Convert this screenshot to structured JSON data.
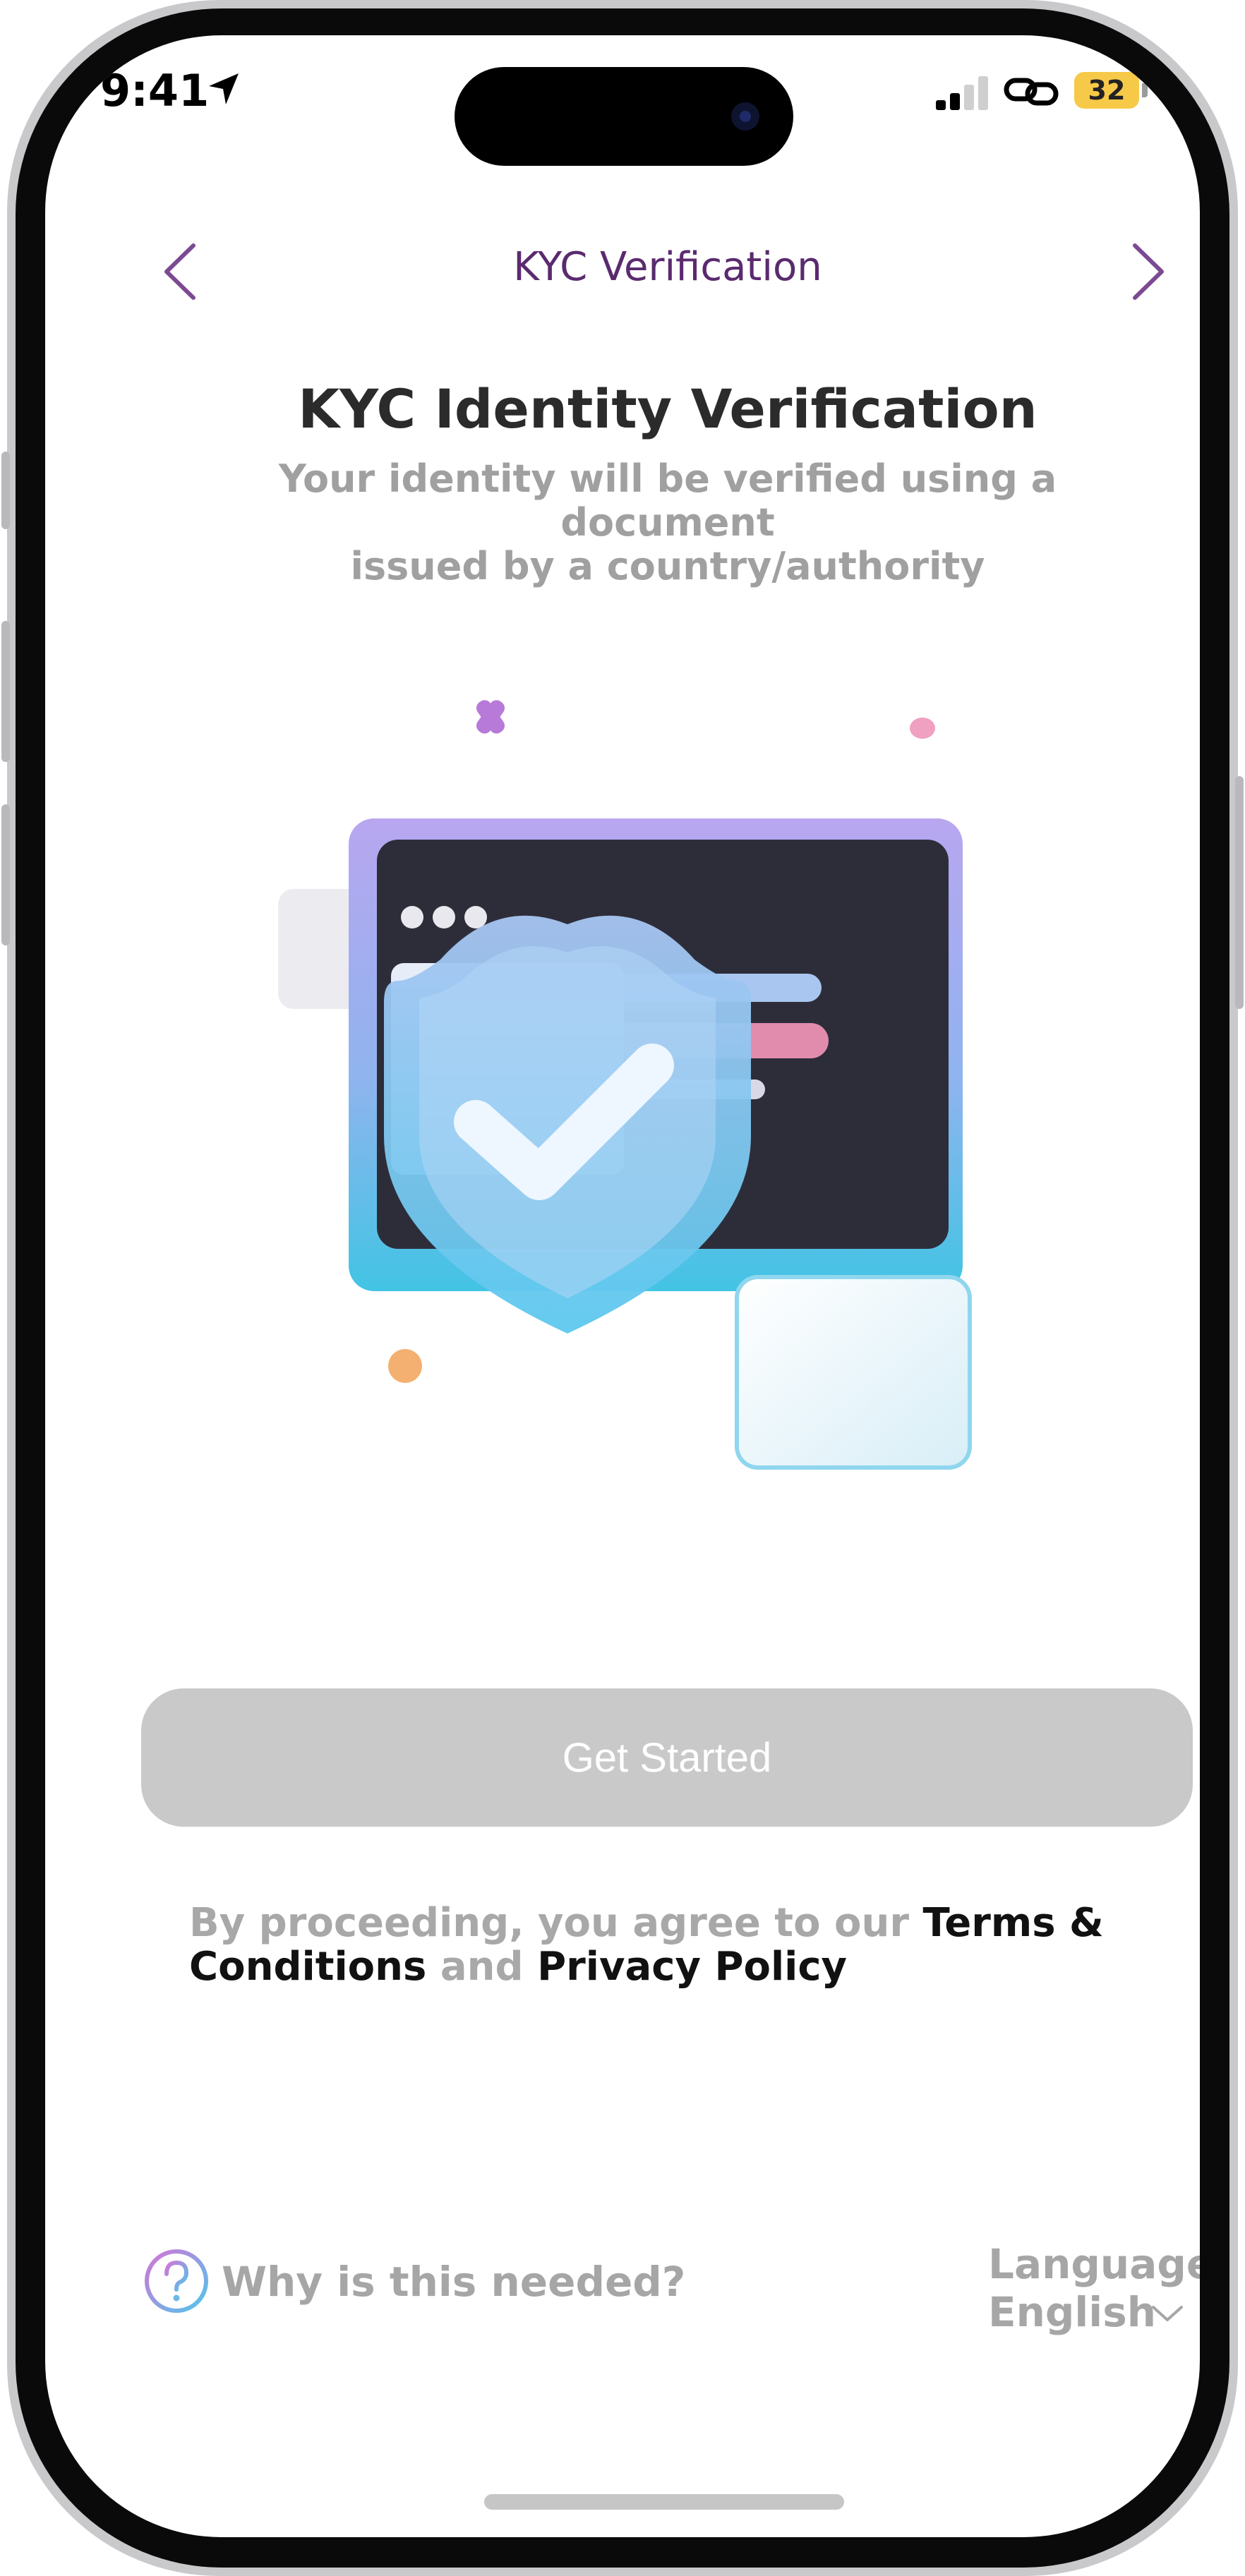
{
  "status_bar": {
    "time": "9:41",
    "battery": "32",
    "battery_color": "#f7c948"
  },
  "nav": {
    "title": "KYC Verification",
    "back_icon": "chevron-left-icon",
    "forward_icon": "chevron-right-icon",
    "accent_color": "#7b4a92"
  },
  "header": {
    "title": "KYC Identity Verification",
    "subtitle_line1": "Your identity will be verified using a document",
    "subtitle_line2": "issued by a country/authority"
  },
  "illustration": {
    "icon": "shield-check-icon"
  },
  "primary_action": {
    "label": "Get Started",
    "state": "disabled",
    "color": "#c9c9c9"
  },
  "legal": {
    "prefix": "By proceeding, you agree to our ",
    "terms_part1": "Terms &",
    "terms_part2": "Conditions",
    "and": " and ",
    "privacy": "Privacy Policy"
  },
  "footer": {
    "help_label": "Why is this needed?",
    "help_icon": "question-circle-icon",
    "language_label": "Language",
    "language_value": "English"
  }
}
